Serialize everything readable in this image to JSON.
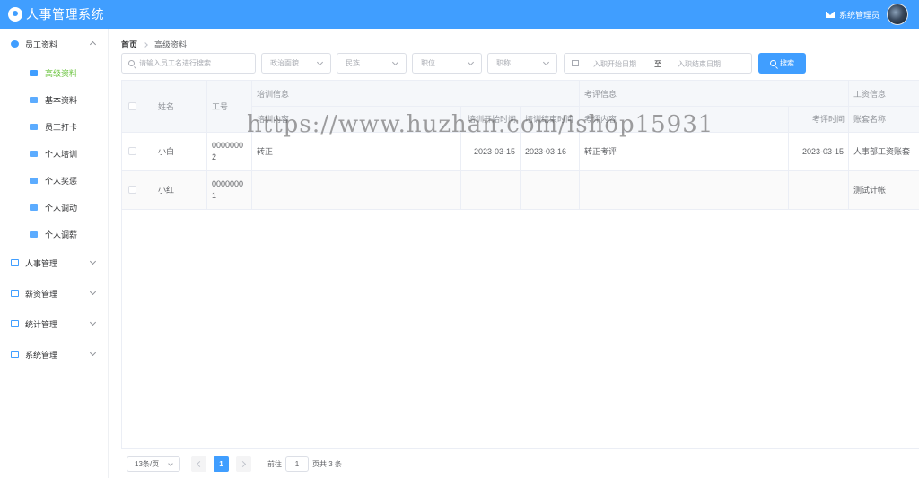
{
  "header": {
    "title": "人事管理系统",
    "user": "系统管理员"
  },
  "sidebar": {
    "groups": [
      {
        "label": "员工资料",
        "icon": "user-circle-icon",
        "expanded": true,
        "items": [
          {
            "label": "高级资料",
            "icon": "id-card-icon",
            "active": true
          },
          {
            "label": "基本资料",
            "icon": "profile-icon",
            "active": false
          },
          {
            "label": "员工打卡",
            "icon": "clock-in-icon",
            "active": false
          },
          {
            "label": "个人培训",
            "icon": "training-icon",
            "active": false
          },
          {
            "label": "个人奖惩",
            "icon": "reward-icon",
            "active": false
          },
          {
            "label": "个人调动",
            "icon": "transfer-icon",
            "active": false
          },
          {
            "label": "个人调薪",
            "icon": "salary-adjust-icon",
            "active": false
          }
        ]
      },
      {
        "label": "人事管理",
        "icon": "hr-card-icon",
        "expanded": false
      },
      {
        "label": "薪资管理",
        "icon": "money-icon",
        "expanded": false
      },
      {
        "label": "统计管理",
        "icon": "bar-chart-icon",
        "expanded": false
      },
      {
        "label": "系统管理",
        "icon": "windows-icon",
        "expanded": false
      }
    ]
  },
  "breadcrumb": {
    "home": "首页",
    "current": "高级资料"
  },
  "filters": {
    "search_placeholder": "请输入员工名进行搜索...",
    "politic": "政治面貌",
    "nation": "民族",
    "position": "职位",
    "title": "职称",
    "date_start": "入职开始日期",
    "date_sep": "至",
    "date_end": "入职结束日期",
    "search_button": "搜索"
  },
  "table": {
    "group_headers": {
      "training": "培训信息",
      "evaluation": "考评信息",
      "salary": "工资信息"
    },
    "headers": {
      "name": "姓名",
      "emp_no": "工号",
      "train_content": "培训内容",
      "train_start": "培训开始时间",
      "train_end": "培训结束时间",
      "eval_content": "考评内容",
      "eval_time": "考评时间",
      "account": "账套名称"
    },
    "rows": [
      {
        "name": "小白",
        "emp_no": "00000002",
        "train_content": "转正",
        "train_start": "2023-03-15",
        "train_end": "2023-03-16",
        "eval_content": "转正考评",
        "eval_time": "2023-03-15",
        "account": "人事部工资账套"
      },
      {
        "name": "小红",
        "emp_no": "00000001",
        "train_content": "",
        "train_start": "",
        "train_end": "",
        "eval_content": "",
        "eval_time": "",
        "account": "测试计帐"
      }
    ]
  },
  "pagination": {
    "page_size": "13条/页",
    "current_page": "1",
    "goto_label": "前往",
    "goto_value": "1",
    "total": "页共 3 条"
  },
  "watermark": "https://www.huzhan.com/ishop15931"
}
